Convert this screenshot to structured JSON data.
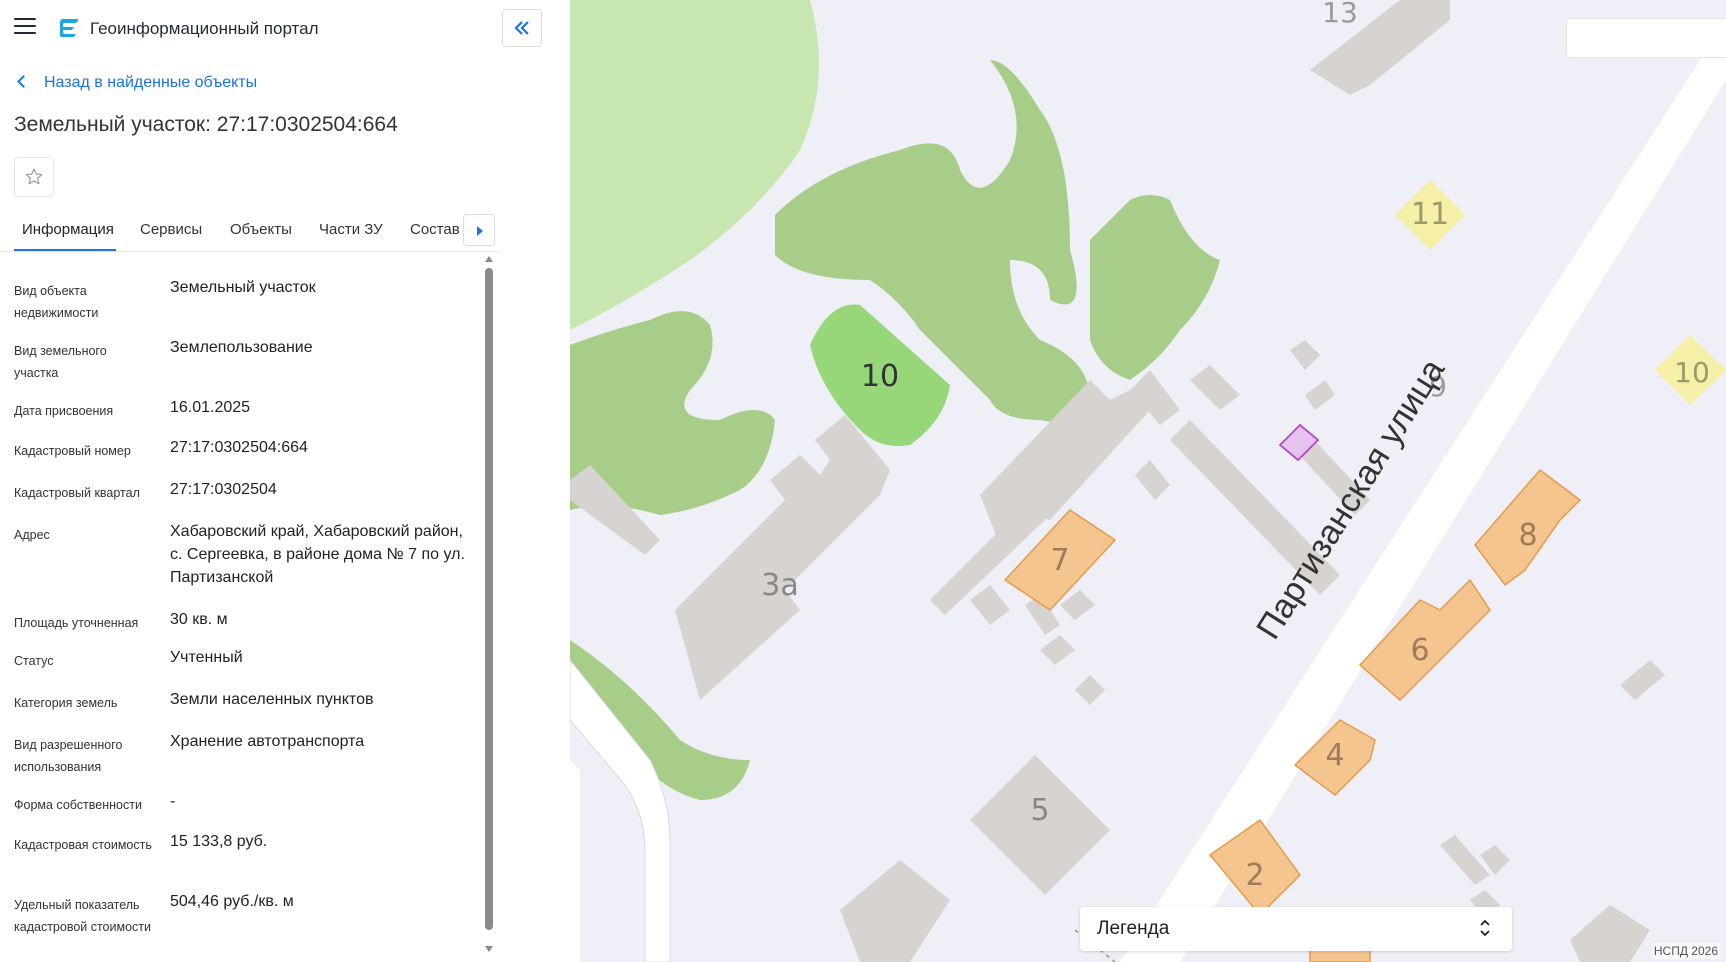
{
  "header": {
    "app_title": "Геоинформационный портал"
  },
  "navigation": {
    "back_label": "Назад в найденные объекты"
  },
  "object": {
    "title": "Земельный участок: 27:17:0302504:664"
  },
  "tabs": [
    {
      "label": "Информация",
      "active": true
    },
    {
      "label": "Сервисы",
      "active": false
    },
    {
      "label": "Объекты",
      "active": false
    },
    {
      "label": "Части ЗУ",
      "active": false
    },
    {
      "label": "Состав",
      "active": false
    }
  ],
  "info": [
    {
      "label": "Вид объекта недвижимости",
      "value": "Земельный участок"
    },
    {
      "label": "Вид земельного участка",
      "value": "Землепользование"
    },
    {
      "label": "Дата присвоения",
      "value": "16.01.2025"
    },
    {
      "label": "Кадастровый номер",
      "value": "27:17:0302504:664"
    },
    {
      "label": "Кадастровый квартал",
      "value": "27:17:0302504"
    },
    {
      "label": "Адрес",
      "value": "Хабаровский край, Хабаровский район, с. Сергеевка, в районе дома № 7 по ул. Партизанской"
    },
    {
      "label": "Площадь уточненная",
      "value": "30 кв. м"
    },
    {
      "label": "Статус",
      "value": "Учтенный"
    },
    {
      "label": "Категория земель",
      "value": "Земли населенных пунктов"
    },
    {
      "label": "Вид разрешенного использования",
      "value": "Хранение автотранспорта"
    },
    {
      "label": "Форма собственности",
      "value": "-"
    },
    {
      "label": "Кадастровая стоимость",
      "value": "15 133,8 руб."
    },
    {
      "label": "Удельный показатель кадастровой стоимости",
      "value": "504,46 руб./кв. м"
    }
  ],
  "map": {
    "street_label": "Партизанская улица",
    "building_labels": {
      "b13": "13",
      "b11": "11",
      "b10_green": "10",
      "b9": "9",
      "b10_right": "10",
      "b7": "7",
      "b8": "8",
      "b6": "6",
      "b3a": "3а",
      "b4": "4",
      "b5": "5",
      "b2": "2"
    },
    "legend_label": "Легенда",
    "copyright": "НСПД 2026",
    "colors": {
      "background": "#efeff7",
      "greenery": "#a7cd89",
      "light_greenery": "#c8e6b0",
      "bright_green": "#98d67a",
      "building_gray": "#d6d3d0",
      "building_orange": "#f4c58e",
      "building_yellow": "#f5efa8",
      "road": "#ffffff",
      "selected_parcel": "#b44ac8",
      "accent": "#1a73e8"
    }
  }
}
